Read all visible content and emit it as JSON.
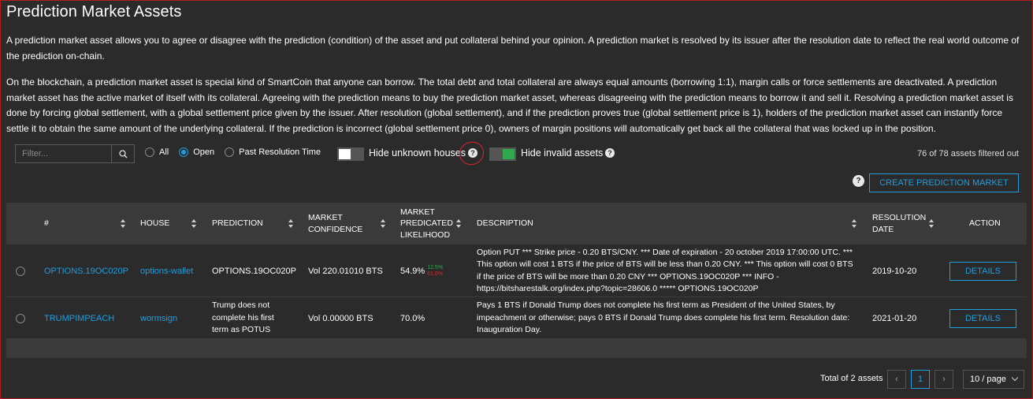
{
  "page": {
    "title": "Prediction Market Assets",
    "intro_1": "A prediction market asset allows you to agree or disagree with the prediction (condition) of the asset and put collateral behind your opinion. A prediction market is resolved by its issuer after the resolution date to reflect the real world outcome of the prediction on-chain.",
    "intro_2": "On the blockchain, a prediction market asset is special kind of SmartCoin that anyone can borrow. The total debt and total collateral are always equal amounts (borrowing 1:1), margin calls or force settlements are deactivated. A prediction market asset has the active market of itself with its collateral. Agreeing with the prediction means to buy the prediction market asset, whereas disagreeing with the prediction means to borrow it and sell it. Resolving a prediction market asset is done by forcing global settlement, with a global settlement price given by the issuer. After resolution (global settlement), and if the prediction proves true (global settlement price is 1), holders of the prediction market asset can instantly force settle it to obtain the same amount of the underlying collateral. If the prediction is incorrect (global settlement price 0), owners of margin positions will automatically get back all the collateral that was locked up in the position."
  },
  "filters": {
    "placeholder": "Filter...",
    "radio_all": "All",
    "radio_open": "Open",
    "radio_past": "Past Resolution Time",
    "selected": "Open",
    "hide_unknown_label": "Hide unknown houses",
    "hide_unknown_on": false,
    "hide_invalid_label": "Hide invalid assets",
    "hide_invalid_on": true,
    "filtered_count": "76 of 78 assets filtered out"
  },
  "actions": {
    "create_label": "CREATE PREDICTION MARKET"
  },
  "table": {
    "headers": {
      "num": "#",
      "house": "HOUSE",
      "prediction": "PREDICTION",
      "confidence_1": "MARKET",
      "confidence_2": "CONFIDENCE",
      "likelihood_1": "MARKET",
      "likelihood_2": "PREDICATED",
      "likelihood_3": "LIKELIHOOD",
      "description": "DESCRIPTION",
      "resolution_1": "RESOLUTION",
      "resolution_2": "DATE",
      "action": "ACTION"
    },
    "rows": [
      {
        "asset": "OPTIONS.19OC020P",
        "house": "options-wallet",
        "prediction": "OPTIONS.19OC020P",
        "confidence": "Vol 220.01010 BTS",
        "likelihood": "54.9%",
        "likelihood_up": "12.5%",
        "likelihood_down": "61.0%",
        "description": "Option PUT *** Strike price - 0.20 BTS/CNY. *** Date of expiration - 20 october 2019 17:00:00 UTC. *** This option will cost 1 BTS if the price of BTS will be less than 0.20 CNY. *** This option will cost 0 BTS if the price of BTS will be more than 0.20 CNY *** OPTIONS.19OC020P *** INFO - https://bitsharestalk.org/index.php?topic=28606.0 ***** OPTIONS.19OC020P",
        "resolution": "2019-10-20",
        "action": "DETAILS"
      },
      {
        "asset": "TRUMPIMPEACH",
        "house": "wormsign",
        "prediction": "Trump does not complete his first term as POTUS",
        "confidence": "Vol 0.00000 BTS",
        "likelihood": "70.0%",
        "description": "Pays 1 BTS if Donald Trump does not complete his first term as President of the United States, by impeachment or otherwise; pays 0 BTS if Donald Trump does complete his first term. Resolution date: Inauguration Day.",
        "resolution": "2021-01-20",
        "action": "DETAILS"
      }
    ]
  },
  "pagination": {
    "total": "Total of 2 assets",
    "current_page": "1",
    "page_size": "10 / page"
  },
  "colors": {
    "accent": "#1e9fe0",
    "toggle_on": "#2fa84f",
    "annotation": "#d9262c"
  }
}
